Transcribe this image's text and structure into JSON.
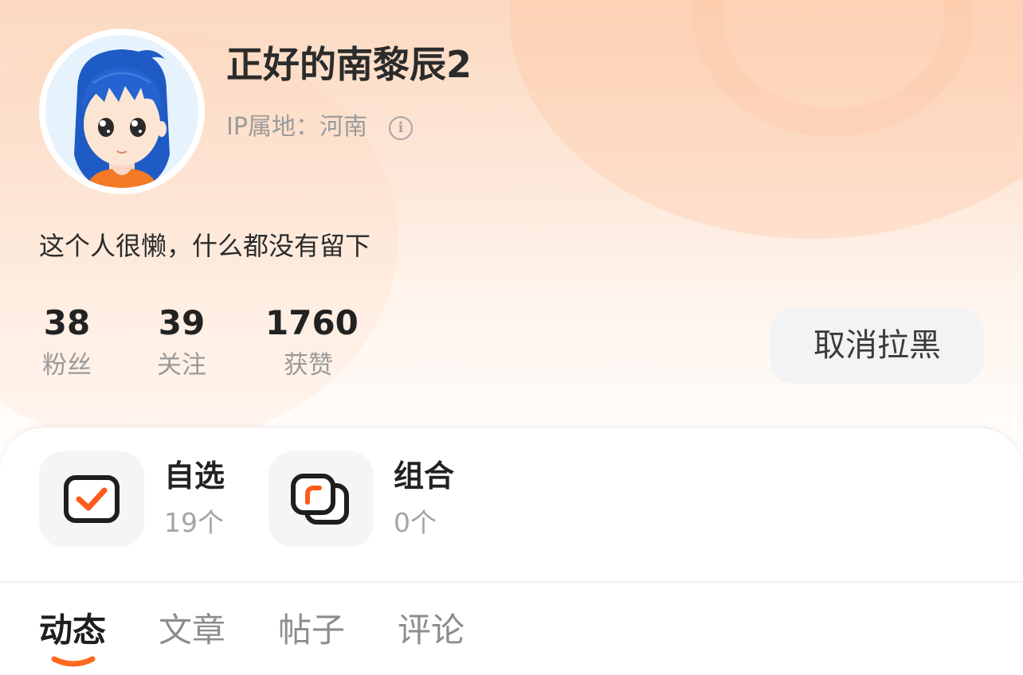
{
  "profile": {
    "username": "正好的南黎辰2",
    "ip_location": "IP属地：河南",
    "bio": "这个人很懒，什么都没有留下"
  },
  "stats": [
    {
      "value": "38",
      "label": "粉丝"
    },
    {
      "value": "39",
      "label": "关注"
    },
    {
      "value": "1760",
      "label": "获赞"
    }
  ],
  "actions": {
    "unblock_label": "取消拉黑"
  },
  "portfolio": [
    {
      "title": "自选",
      "count": "19个",
      "icon": "checkbox-icon"
    },
    {
      "title": "组合",
      "count": "0个",
      "icon": "stacked-squares-icon"
    }
  ],
  "tabs": [
    {
      "label": "动态",
      "active": true
    },
    {
      "label": "文章",
      "active": false
    },
    {
      "label": "帖子",
      "active": false
    },
    {
      "label": "评论",
      "active": false
    }
  ],
  "colors": {
    "accent": "#ff6a1f",
    "header_gradient_top": "#fcd9c0",
    "text_primary": "#222222",
    "text_secondary": "#9a9a9a"
  }
}
